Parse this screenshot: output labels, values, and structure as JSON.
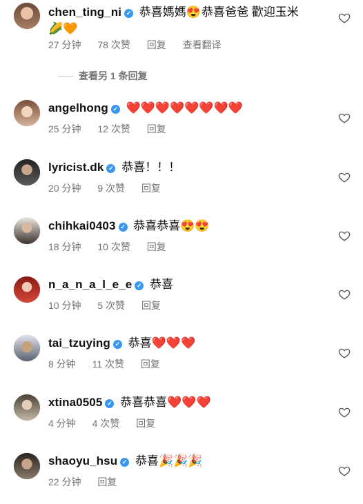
{
  "comments": [
    {
      "username": "chen_ting_ni",
      "text": "恭喜媽媽",
      "emoji1": "😍",
      "text2": "恭喜爸爸 歡迎玉米",
      "emoji2": "🌽🧡",
      "time": "27 分钟",
      "likes": "78 次赞",
      "reply": "回复",
      "translate": "查看翻译",
      "avatar_color": "#a87d62"
    },
    {
      "username": "angelhong",
      "text": "",
      "emoji1": "❤️❤️❤️❤️❤️❤️❤️❤️",
      "time": "25 分钟",
      "likes": "12 次赞",
      "reply": "回复",
      "avatar_color": "#c99a7a"
    },
    {
      "username": "lyricist.dk",
      "text": "恭喜！！！",
      "time": "20 分钟",
      "likes": "9 次赞",
      "reply": "回复",
      "avatar_color": "#3a3a3a"
    },
    {
      "username": "chihkai0403",
      "text": "恭喜恭喜",
      "emoji1": "😍😍",
      "time": "18 分钟",
      "likes": "10 次赞",
      "reply": "回复",
      "avatar_color": "#6f5f57"
    },
    {
      "username": "n_a_n_a_l_e_e",
      "text": "恭喜",
      "time": "10 分钟",
      "likes": "5 次赞",
      "reply": "回复",
      "avatar_color": "#b3261e"
    },
    {
      "username": "tai_tzuying",
      "text": "恭喜",
      "emoji1": "❤️❤️❤️",
      "time": "8 分钟",
      "likes": "11 次赞",
      "reply": "回复",
      "avatar_color": "#8b8fa0"
    },
    {
      "username": "xtina0505",
      "text": "恭喜恭喜",
      "emoji1": "❤️❤️❤️",
      "time": "4 分钟",
      "likes": "4 次赞",
      "reply": "回复",
      "avatar_color": "#a79a88"
    },
    {
      "username": "shaoyu_hsu",
      "text": "恭喜",
      "emoji1": "🎉🎉🎉",
      "time": "22 分钟",
      "reply": "回复",
      "avatar_color": "#4a4038"
    }
  ],
  "more_replies": "查看另 1 条回复",
  "colors": {
    "verified": "#3897f0",
    "meta": "#737373"
  }
}
